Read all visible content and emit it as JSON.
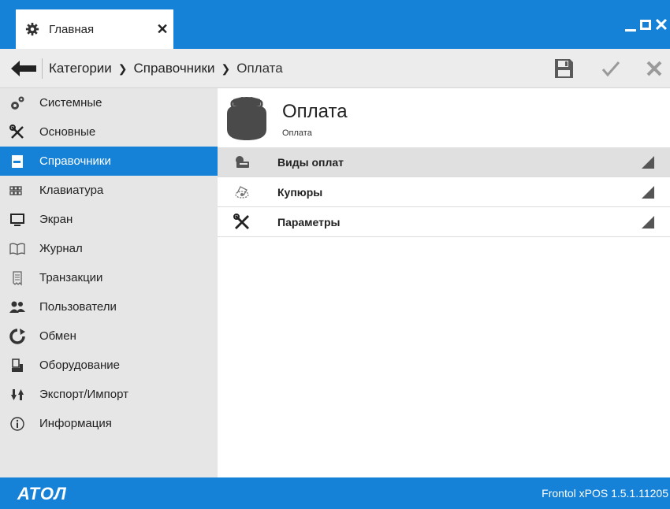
{
  "window": {
    "tab_label": "Главная",
    "tab_icon": "gear-icon",
    "controls": [
      "minimize-icon",
      "maximize-icon",
      "close-icon"
    ]
  },
  "toolbar": {
    "breadcrumb": [
      "Категории",
      "Справочники",
      "Оплата"
    ],
    "back_icon": "arrow-left-icon",
    "save_icon": "floppy-disk-icon",
    "ok_icon": "checkmark-icon",
    "cancel_icon": "close-icon"
  },
  "sidebar": {
    "items": [
      {
        "label": "Системные",
        "icon": "gears-icon"
      },
      {
        "label": "Основные",
        "icon": "tools-icon"
      },
      {
        "label": "Справочники",
        "icon": "reference-book-icon",
        "active": true
      },
      {
        "label": "Клавиатура",
        "icon": "keyboard-icon"
      },
      {
        "label": "Экран",
        "icon": "monitor-icon"
      },
      {
        "label": "Журнал",
        "icon": "journal-icon"
      },
      {
        "label": "Транзакции",
        "icon": "receipt-icon"
      },
      {
        "label": "Пользователи",
        "icon": "users-icon"
      },
      {
        "label": "Обмен",
        "icon": "sync-icon"
      },
      {
        "label": "Оборудование",
        "icon": "pos-terminal-icon"
      },
      {
        "label": "Экспорт/Импорт",
        "icon": "export-import-icon"
      },
      {
        "label": "Информация",
        "icon": "info-icon"
      }
    ]
  },
  "main": {
    "title": "Оплата",
    "subtitle": "Оплата",
    "header_icon": "wallet-icon",
    "rows": [
      {
        "label": "Виды оплат",
        "icon": "payment-types-icon",
        "selected": true
      },
      {
        "label": "Купюры",
        "icon": "banknotes-icon",
        "selected": false
      },
      {
        "label": "Параметры",
        "icon": "tools-icon",
        "selected": false
      }
    ]
  },
  "footer": {
    "logo": "АТОЛ",
    "version": "Frontol xPOS 1.5.1.11205"
  },
  "colors": {
    "accent": "#1582d8",
    "sidebar_bg": "#e6e6e6",
    "selected_row": "#e0e0e0"
  }
}
